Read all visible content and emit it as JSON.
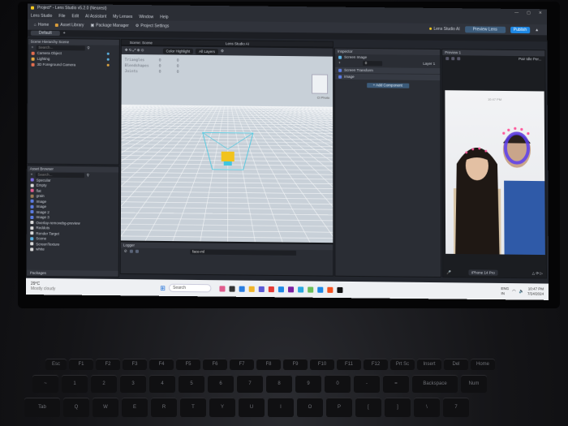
{
  "window": {
    "title": "Project* - Lens Studio v5.2.0 (Nearest)",
    "controls": [
      "—",
      "▢",
      "✕"
    ]
  },
  "menu": [
    "Lens Studio",
    "File",
    "Edit",
    "AI Assistant",
    "My Lenses",
    "Window",
    "Help"
  ],
  "toolbar": {
    "home": "Home",
    "asset_library": "Asset Library",
    "package_manager": "Package Manager",
    "project_settings": "Project Settings",
    "ai_badge": "Lens Studio AI",
    "preview_lens": "Preview Lens",
    "publish": "Publish"
  },
  "tabs": {
    "default": "Default",
    "add": "+"
  },
  "scene_hierarchy": {
    "title": "Scene Hierarchy Scene",
    "search_placeholder": "Search...",
    "items": [
      {
        "label": "Camera Object",
        "color": "#e26d4f"
      },
      {
        "label": "Lighting",
        "color": "#e0a640"
      },
      {
        "label": "3D Foreground Camera",
        "color": "#e26d4f"
      }
    ]
  },
  "asset_browser": {
    "title": "Asset Browser",
    "search_placeholder": "Search...",
    "items": [
      {
        "label": "Specular",
        "color": "#7b6be0"
      },
      {
        "label": "Empty",
        "color": "#d8d8d8"
      },
      {
        "label": "flat",
        "color": "#e05b8c"
      },
      {
        "label": "grain",
        "color": "#9a7a55"
      },
      {
        "label": "Image",
        "color": "#5b7be0"
      },
      {
        "label": "Image",
        "color": "#5b7be0"
      },
      {
        "label": "Image 2",
        "color": "#5b7be0"
      },
      {
        "label": "Image 3",
        "color": "#5b7be0"
      },
      {
        "label": "Overlay-removebg-preview",
        "color": "#d8d8d8"
      },
      {
        "label": "Reddots",
        "color": "#d8d8d8"
      },
      {
        "label": "Render Target",
        "color": "#d8d8d8"
      },
      {
        "label": "Scene",
        "color": "#5bb0e0"
      },
      {
        "label": "ScreenTexture",
        "color": "#d8d8d8"
      },
      {
        "label": "white",
        "color": "#d8d8d8"
      }
    ],
    "packages": "Packages"
  },
  "scene_view": {
    "tab": "Scene: Scene",
    "ai_tab": "Lens Studio AI",
    "mode": "Color Highlight",
    "layers": "All Layers",
    "stats": [
      {
        "label": "Triangles",
        "a": "0",
        "b": "0"
      },
      {
        "label": "Blendshapes",
        "a": "0",
        "b": "0"
      },
      {
        "label": "Joints",
        "a": "0",
        "b": "0"
      }
    ],
    "camera_label": "Cl Photo"
  },
  "logger": {
    "title": "Logger",
    "search_value": "face-ml"
  },
  "inspector": {
    "title": "Inspector",
    "object_name": "Screen Image",
    "layer_value": "0",
    "layer_label": "Layer 1",
    "components": [
      "Screen Transform",
      "Image"
    ],
    "add_component": "+ Add Component"
  },
  "preview": {
    "title": "Preview 1",
    "mode": "Pair Idle Per...",
    "time": "10:47 PM",
    "device": "iPhone 14 Pro"
  },
  "taskbar": {
    "weather_temp": "29°C",
    "weather_desc": "Mostly cloudy",
    "search": "Search",
    "lang": "ENG",
    "region": "IN",
    "time": "10:47 PM",
    "date": "7/24/2024"
  },
  "keyboard": {
    "row0": [
      "Esc",
      "F1",
      "F2",
      "F3",
      "F4",
      "F5",
      "F6",
      "F7",
      "F8",
      "F9",
      "F10",
      "F11",
      "F12",
      "Prt Sc",
      "Insert",
      "Del",
      "Home"
    ],
    "row1": [
      "~",
      "1",
      "2",
      "3",
      "4",
      "5",
      "6",
      "7",
      "8",
      "9",
      "0",
      "-",
      "=",
      "Backspace",
      "Num"
    ],
    "row2": [
      "Tab",
      "Q",
      "W",
      "E",
      "R",
      "T",
      "Y",
      "U",
      "I",
      "O",
      "P",
      "[",
      "]",
      "\\",
      "7"
    ]
  }
}
